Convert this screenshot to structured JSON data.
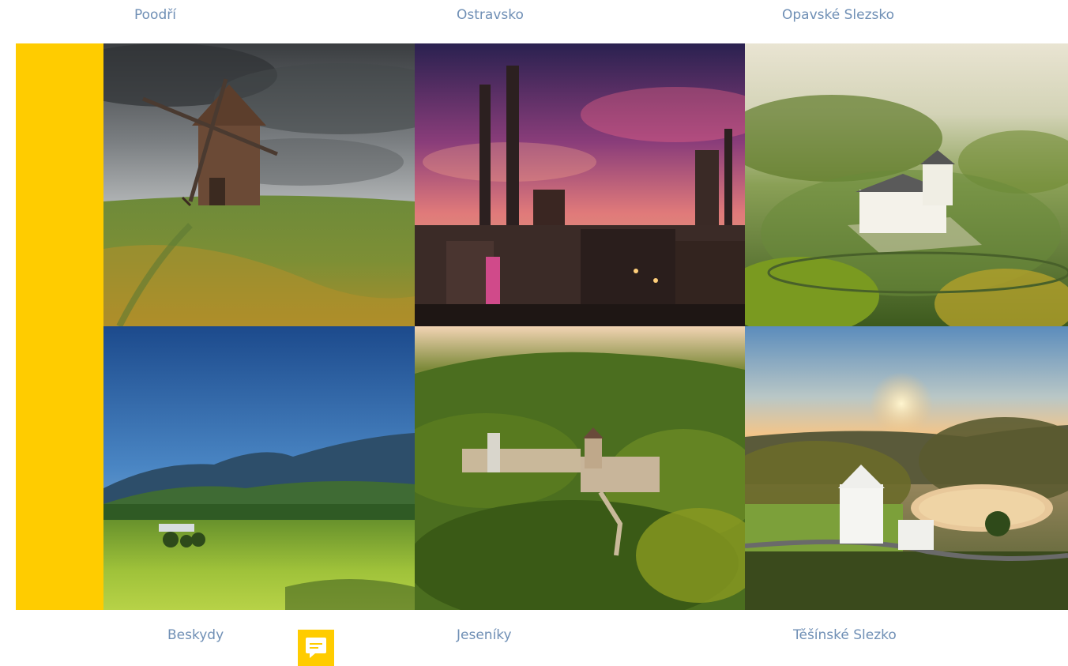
{
  "regions": {
    "top": [
      {
        "label": "Poodří"
      },
      {
        "label": "Ostravsko"
      },
      {
        "label": "Opavské Slezsko"
      }
    ],
    "bottom": [
      {
        "label": "Beskydy"
      },
      {
        "label": "Jeseníky"
      },
      {
        "label": "Těšínské Slezko"
      }
    ]
  },
  "colors": {
    "accent": "#ffcc00",
    "label": "#6f8fb5"
  },
  "chat": {
    "icon": "chat-bubble-icon"
  }
}
